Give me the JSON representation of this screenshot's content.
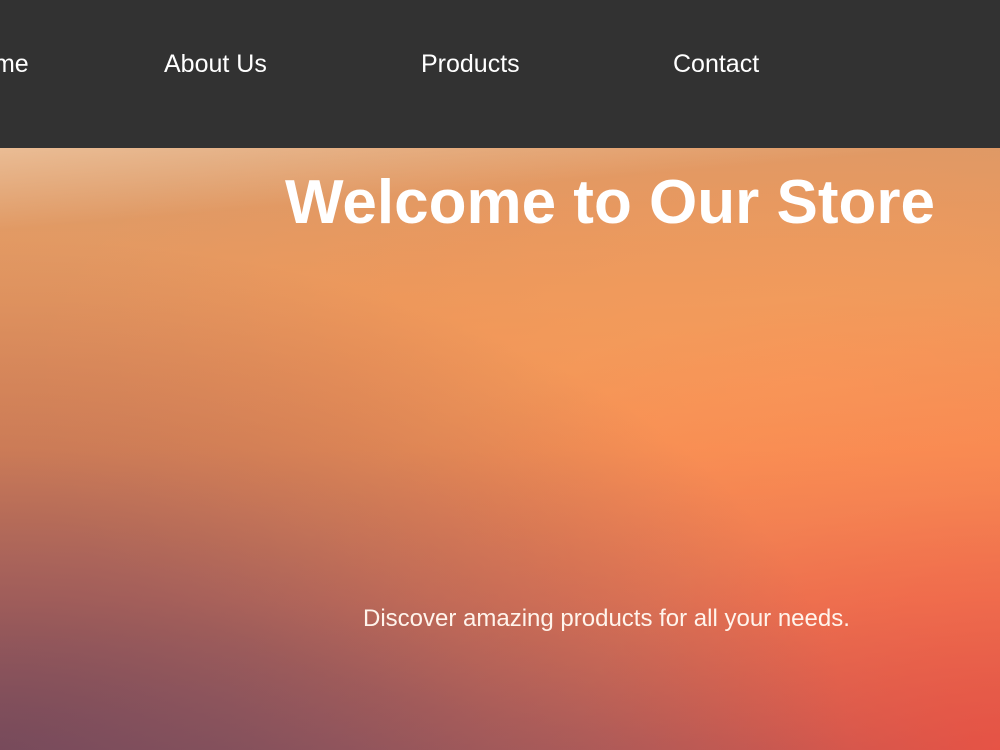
{
  "nav": {
    "items": [
      {
        "label": "Home"
      },
      {
        "label": "About Us"
      },
      {
        "label": "Products"
      },
      {
        "label": "Contact"
      }
    ]
  },
  "hero": {
    "title": "Welcome to Our Store",
    "subtitle": "Discover amazing products for all your needs."
  },
  "colors": {
    "navbar_background": "#323232",
    "text": "#ffffff",
    "hero_top": "#d99a6a",
    "hero_mid": "#f29255",
    "hero_bottom_left": "#9c5c60",
    "hero_bottom_right": "#ff6a4a"
  }
}
